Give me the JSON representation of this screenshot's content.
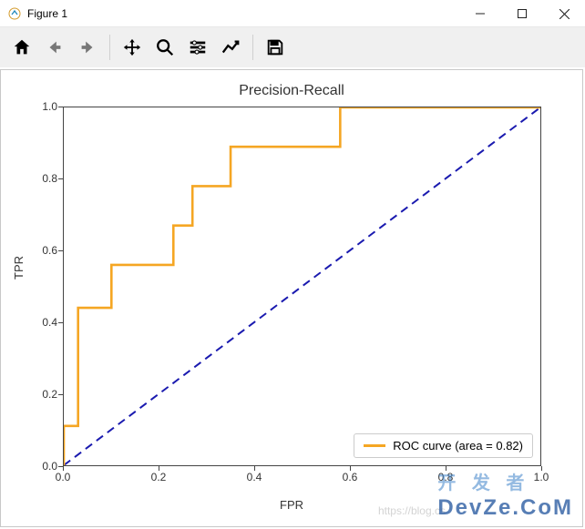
{
  "window": {
    "title": "Figure 1",
    "minimize_icon": "minimize-icon",
    "maximize_icon": "maximize-icon",
    "close_icon": "close-icon"
  },
  "toolbar": {
    "items": [
      {
        "name": "home-icon"
      },
      {
        "name": "back-icon"
      },
      {
        "name": "forward-icon"
      },
      {
        "sep": true
      },
      {
        "name": "pan-icon"
      },
      {
        "name": "zoom-icon"
      },
      {
        "name": "subplots-icon"
      },
      {
        "name": "axes-icon"
      },
      {
        "sep": true
      },
      {
        "name": "save-icon"
      }
    ]
  },
  "watermark": {
    "cn": "开 发 者",
    "en": "DevZe.CoM",
    "faint": "https://blog.cs"
  },
  "chart_data": {
    "type": "line",
    "title": "Precision-Recall",
    "xlabel": "FPR",
    "ylabel": "TPR",
    "xlim": [
      0.0,
      1.0
    ],
    "ylim": [
      0.0,
      1.0
    ],
    "xticks": [
      0.0,
      0.2,
      0.4,
      0.6,
      0.8,
      1.0
    ],
    "yticks": [
      0.0,
      0.2,
      0.4,
      0.6,
      0.8,
      1.0
    ],
    "series": [
      {
        "name": "ROC curve (area = 0.82)",
        "color": "#f5a623",
        "step": true,
        "x": [
          0.0,
          0.0,
          0.03,
          0.03,
          0.1,
          0.1,
          0.23,
          0.23,
          0.27,
          0.27,
          0.35,
          0.35,
          0.58,
          0.58,
          1.0
        ],
        "y": [
          0.0,
          0.11,
          0.11,
          0.44,
          0.44,
          0.56,
          0.56,
          0.67,
          0.67,
          0.78,
          0.78,
          0.89,
          0.89,
          1.0,
          1.0
        ]
      },
      {
        "name": "diagonal",
        "color": "#1a1aaf",
        "dashed": true,
        "x": [
          0.0,
          1.0
        ],
        "y": [
          0.0,
          1.0
        ]
      }
    ],
    "legend": {
      "position": "lower right",
      "entries": [
        "ROC curve (area = 0.82)"
      ]
    }
  }
}
